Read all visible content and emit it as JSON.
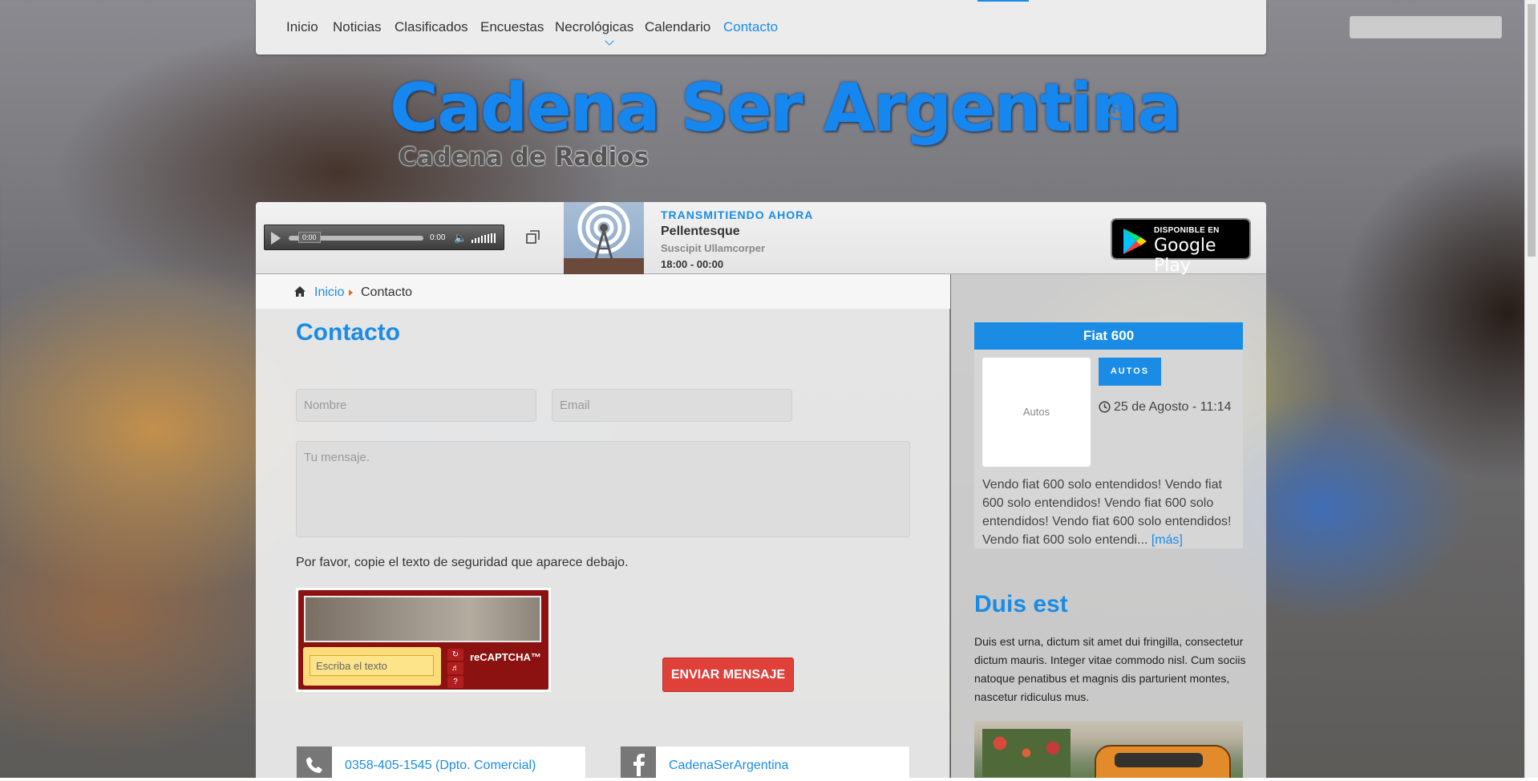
{
  "nav": {
    "items": [
      {
        "label": "Inicio"
      },
      {
        "label": "Noticias"
      },
      {
        "label": "Clasificados"
      },
      {
        "label": "Encuestas"
      },
      {
        "label": "Necrológicas"
      },
      {
        "label": "Calendario"
      },
      {
        "label": "Contacto",
        "active": true
      }
    ]
  },
  "logo": {
    "title": "Cadena Ser Argentina",
    "registered": "R",
    "subtitle": "Cadena de Radios"
  },
  "player": {
    "current_time": "0:00",
    "time_display": "0:00",
    "now_label": "TRANSMITIENDO AHORA",
    "show": "Pellentesque",
    "host": "Suscipit Ullamcorper",
    "schedule": "18:00 - 00:00",
    "gplay_small": "DISPONIBLE EN",
    "gplay_big": "Google Play",
    "progress": 0
  },
  "breadcrumb": {
    "home": "Inicio",
    "current": "Contacto"
  },
  "contact": {
    "title": "Contacto",
    "name_placeholder": "Nombre",
    "email_placeholder": "Email",
    "message_placeholder": "Tu mensaje.",
    "captcha_instructions": "Por favor, copie el texto de seguridad que aparece debajo.",
    "captcha_input_placeholder": "Escriba el texto",
    "captcha_brand": "reCAPTCHA™",
    "send_label": "ENVIAR MENSAJE",
    "phone": "0358-405-1545 (Dpto. Comercial)",
    "facebook": "CadenaSerArgentina"
  },
  "sidebar": {
    "classified": {
      "title": "Fiat 600",
      "image_label": "Autos",
      "tag": "AUTOS",
      "date": "25 de Agosto - 11:14",
      "text": "Vendo fiat 600 solo entendidos! Vendo fiat 600 solo entendidos! Vendo fiat 600 solo entendidos! Vendo fiat 600 solo entendidos! Vendo fiat 600 solo entendi...",
      "more": "[más]"
    },
    "article": {
      "title": "Duis est",
      "text": "Duis est urna, dictum sit amet dui fringilla, consectetur dictum mauris. Integer vitae commodo nisl. Cum sociis natoque penatibus et magnis dis parturient montes, nascetur ridiculus mus."
    }
  },
  "colors": {
    "accent": "#1a8ce6",
    "send_button": "#e0403a",
    "captcha_red": "#8c1212"
  }
}
